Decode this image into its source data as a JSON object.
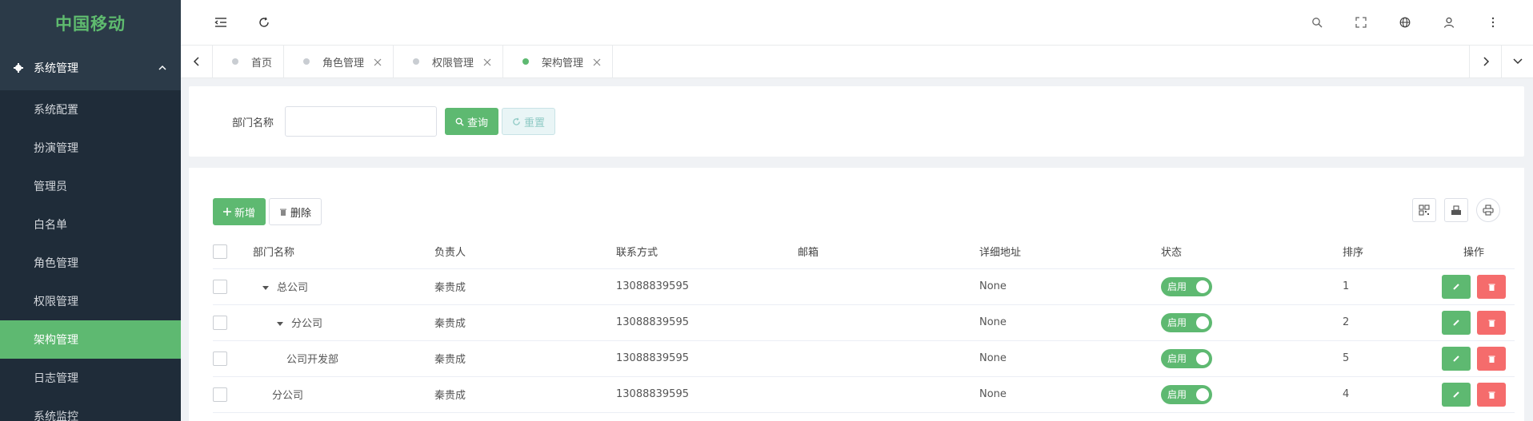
{
  "brand": "中国移动",
  "sidebar": {
    "group": "系统管理",
    "items": [
      {
        "label": "系统配置",
        "active": false
      },
      {
        "label": "扮演管理",
        "active": false
      },
      {
        "label": "管理员",
        "active": false
      },
      {
        "label": "白名单",
        "active": false
      },
      {
        "label": "角色管理",
        "active": false
      },
      {
        "label": "权限管理",
        "active": false
      },
      {
        "label": "架构管理",
        "active": true
      },
      {
        "label": "日志管理",
        "active": false
      },
      {
        "label": "系统监控",
        "active": false
      }
    ]
  },
  "tabs": [
    {
      "label": "首页",
      "closable": false,
      "active": false
    },
    {
      "label": "角色管理",
      "closable": true,
      "active": false
    },
    {
      "label": "权限管理",
      "closable": true,
      "active": false
    },
    {
      "label": "架构管理",
      "closable": true,
      "active": true
    }
  ],
  "search": {
    "label": "部门名称",
    "value": "",
    "query_label": "查询",
    "reset_label": "重置"
  },
  "toolbar": {
    "add_label": "新增",
    "delete_label": "删除"
  },
  "table": {
    "columns": [
      "部门名称",
      "负责人",
      "联系方式",
      "邮箱",
      "详细地址",
      "状态",
      "排序",
      "操作"
    ],
    "rows": [
      {
        "name": "总公司",
        "leader": "秦贵成",
        "contact": "13088839595",
        "email": "",
        "address": "None",
        "status": "启用",
        "order": "1"
      },
      {
        "name": "分公司",
        "leader": "秦贵成",
        "contact": "13088839595",
        "email": "",
        "address": "None",
        "status": "启用",
        "order": "2"
      },
      {
        "name": "公司开发部",
        "leader": "秦贵成",
        "contact": "13088839595",
        "email": "",
        "address": "None",
        "status": "启用",
        "order": "5"
      },
      {
        "name": "分公司",
        "leader": "秦贵成",
        "contact": "13088839595",
        "email": "",
        "address": "None",
        "status": "启用",
        "order": "4"
      }
    ]
  },
  "colors": {
    "accent": "#5eb971",
    "danger": "#f56c6c",
    "sidebar_bg": "#1f2c39"
  }
}
